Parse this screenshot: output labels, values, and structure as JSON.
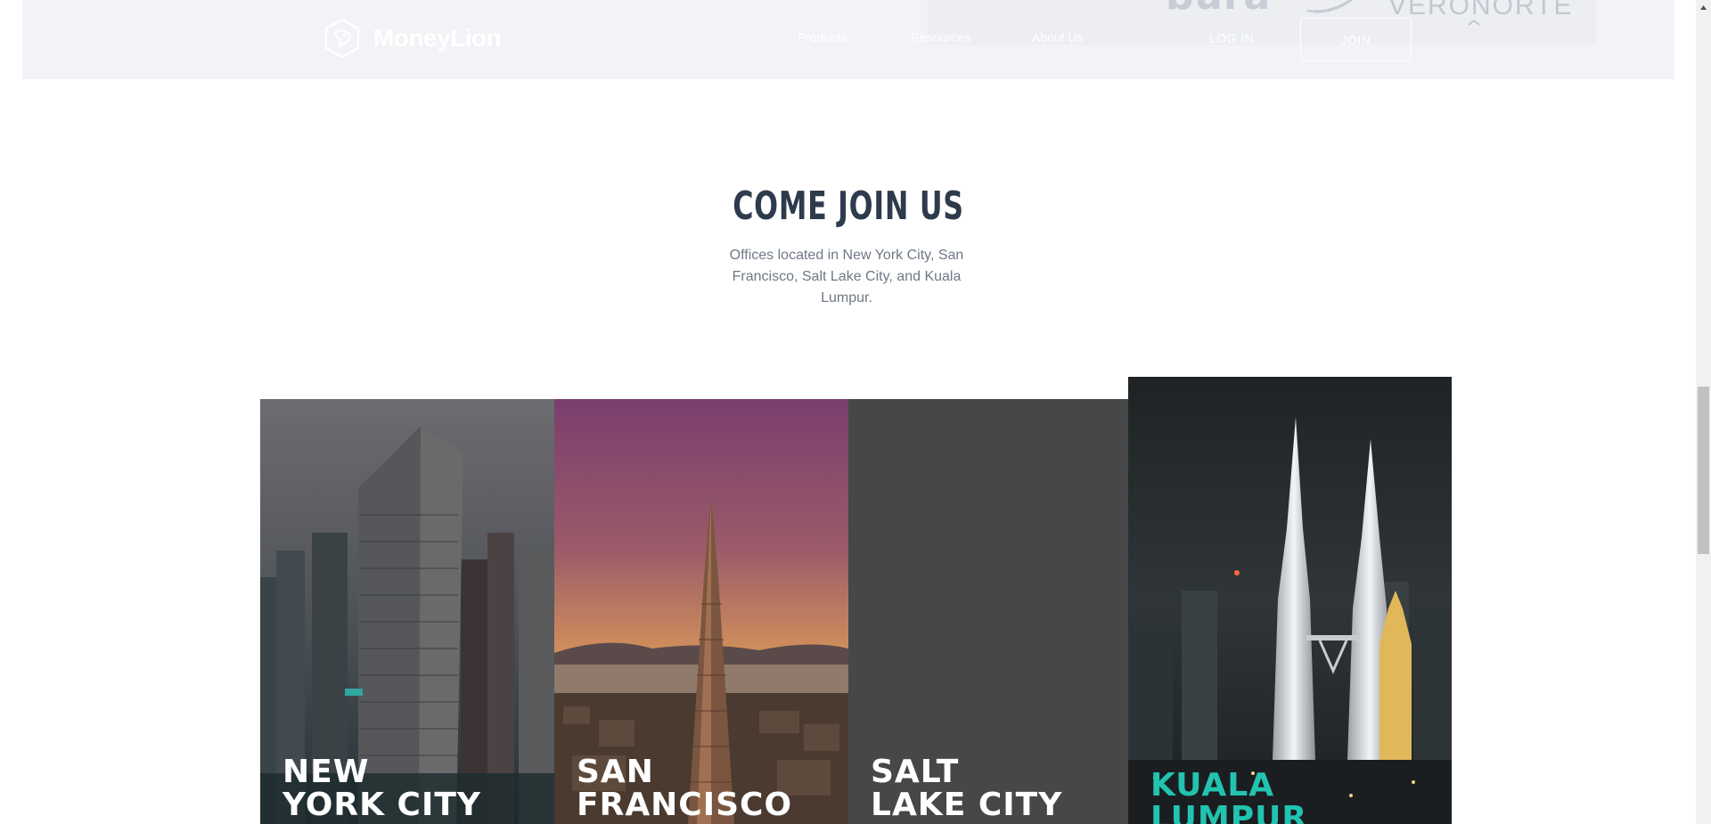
{
  "header": {
    "brand_name": "MoneyLion",
    "logo_icon": "moneylion-lion-icon",
    "nav": [
      {
        "label": "Products"
      },
      {
        "label": "Resources"
      },
      {
        "label": "About Us"
      }
    ],
    "login_label": "LOG IN",
    "join_label": "JOIN"
  },
  "partners": {
    "logo_a": "bura",
    "logo_b": "VERONORTE"
  },
  "section": {
    "title": "COME JOIN US",
    "subtitle": "Offices located in New York City, San Francisco, Salt Lake City, and Kuala Lumpur."
  },
  "offices": [
    {
      "line1": "NEW",
      "line2": "YORK CITY"
    },
    {
      "line1": "SAN",
      "line2": "FRANCISCO"
    },
    {
      "line1": "SALT",
      "line2": "LAKE CITY"
    },
    {
      "line1": "KUALA",
      "line2": "LUMPUR"
    }
  ],
  "colors": {
    "header_bg": "#f2f3f6",
    "title": "#2d3b4c",
    "subtitle": "#6f7885",
    "accent_teal": "#22c3b0",
    "slc_tile": "#474747"
  }
}
